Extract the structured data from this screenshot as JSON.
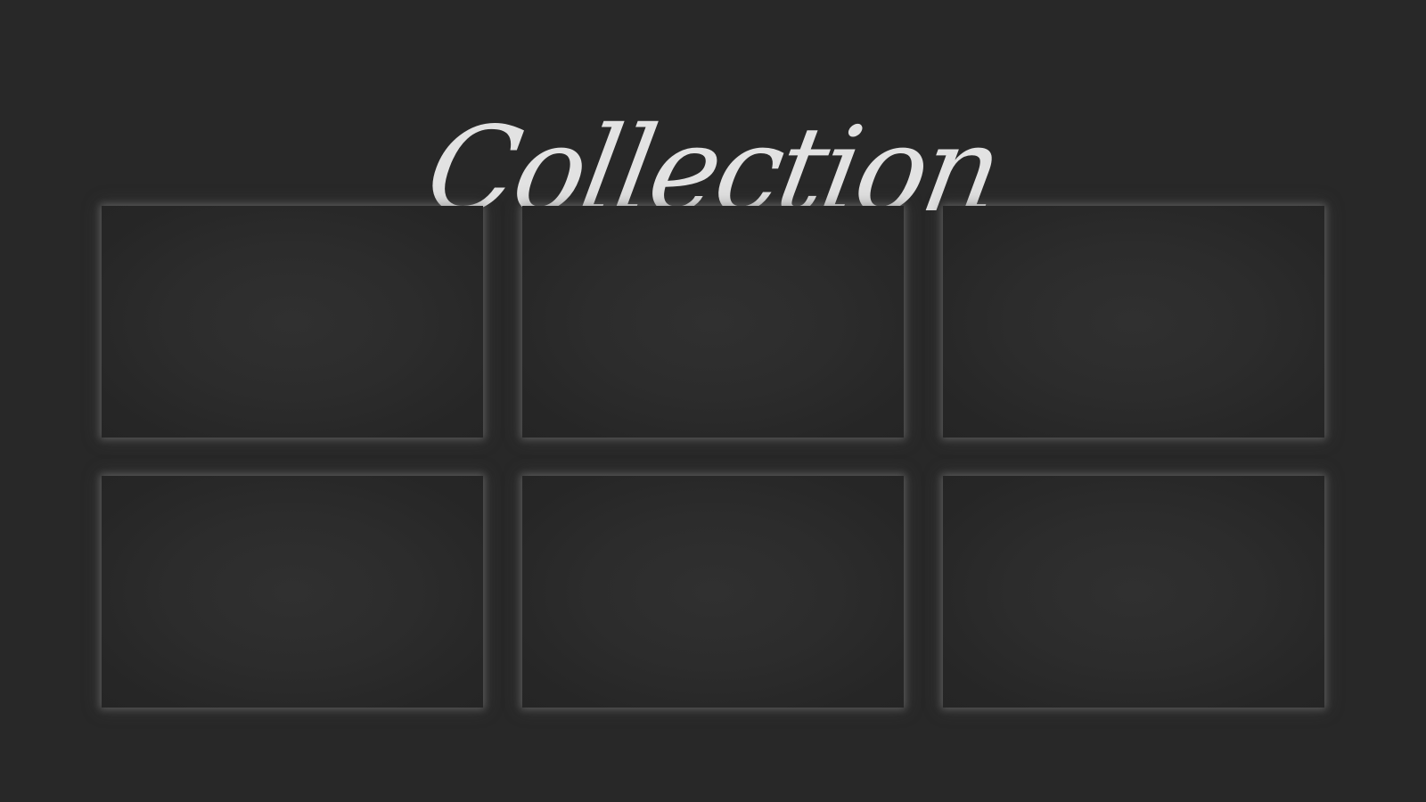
{
  "header": {
    "title": "Collection"
  },
  "colors": {
    "background": "#282828",
    "title": "#e2e2e2",
    "card_center": "#303030",
    "card_edge": "#252525",
    "card_glow": "#8c8c8c"
  },
  "gallery": {
    "columns": 3,
    "rows": 2,
    "items": [
      {
        "slot": 1
      },
      {
        "slot": 2
      },
      {
        "slot": 3
      },
      {
        "slot": 4
      },
      {
        "slot": 5
      },
      {
        "slot": 6
      }
    ]
  }
}
